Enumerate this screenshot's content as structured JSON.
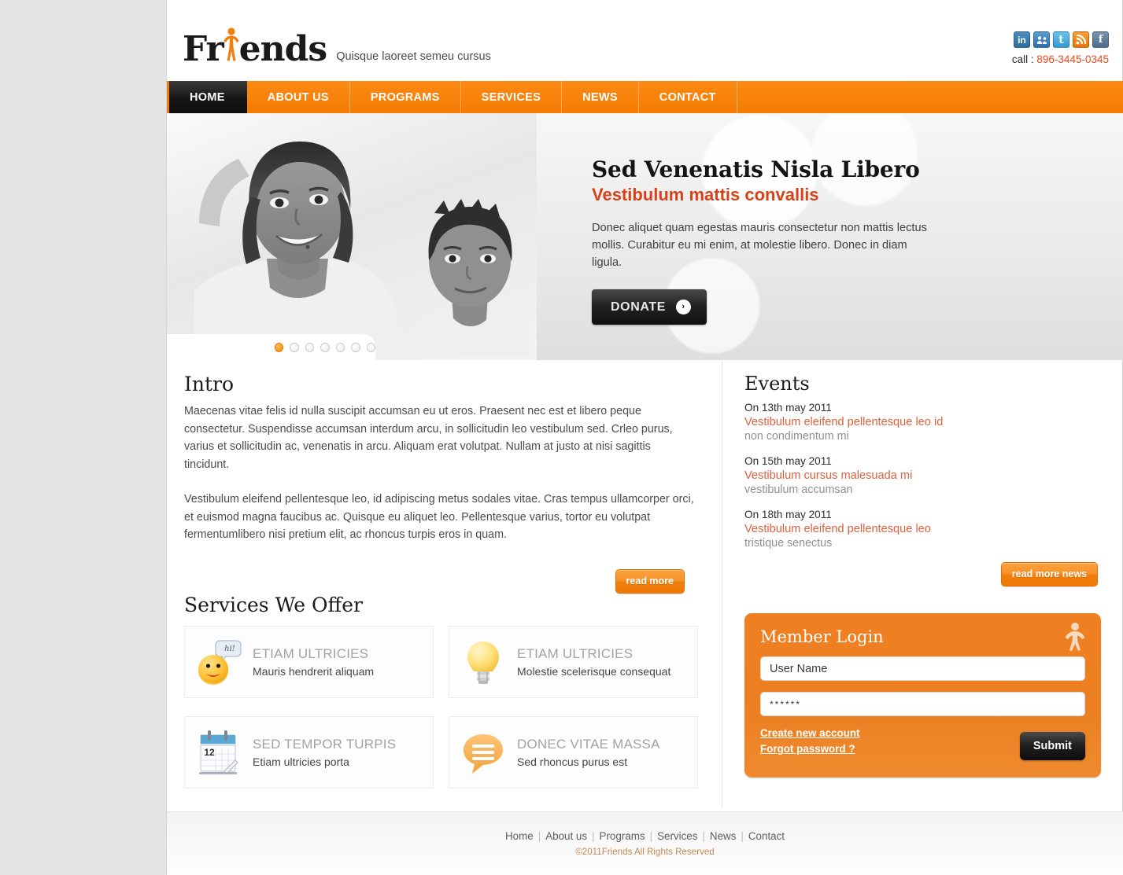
{
  "header": {
    "logo_main_1": "Fr",
    "logo_main_2": "ends",
    "logo_icon": "person-raised-arms-icon",
    "tagline": "Quisque laoreet semeu cursus",
    "call_label": "call : ",
    "phone": "896-3445-0345",
    "social": [
      {
        "name": "linkedin-icon",
        "glyph": "in",
        "class": "sicon-linkedin"
      },
      {
        "name": "myspace-icon",
        "glyph": "⚘",
        "class": "sicon-myspace"
      },
      {
        "name": "twitter-icon",
        "glyph": "t",
        "class": "sicon-twitter"
      },
      {
        "name": "rss-icon",
        "glyph": "◠",
        "class": "sicon-rss"
      },
      {
        "name": "facebook-icon",
        "glyph": "f",
        "class": "sicon-facebook"
      }
    ]
  },
  "nav": {
    "items": [
      {
        "label": "HOME",
        "active": true
      },
      {
        "label": "ABOUT US",
        "active": false
      },
      {
        "label": "PROGRAMS",
        "active": false
      },
      {
        "label": "SERVICES",
        "active": false
      },
      {
        "label": "NEWS",
        "active": false
      },
      {
        "label": "CONTACT",
        "active": false
      }
    ]
  },
  "slider": {
    "heading": "Sed Venenatis Nisla Libero",
    "subheading": "Vestibulum mattis convallis",
    "body": "Donec aliquet quam egestas mauris consectetur non mattis lectus mollis. Curabitur eu mi enim, at molestie libero. Donec in diam ligula.",
    "button_label": "DONATE",
    "button_arrow": "›",
    "dots_total": 7,
    "dot_active_index": 0,
    "image_alt": "black-and-white photo of two smiling children"
  },
  "intro": {
    "title": "Intro",
    "paragraph1": "Maecenas vitae felis id nulla suscipit accumsan eu ut eros. Praesent nec est et libero peque consectetur. Suspendisse accumsan interdum arcu, in sollicitudin leo vestibulum sed. Crleo purus, varius et sollicitudin ac, venenatis in arcu. Aliquam erat volutpat. Nullam at justo at nisi sagittis tincidunt.",
    "paragraph2": "Vestibulum eleifend pellentesque leo, id adipiscing metus sodales vitae. Cras tempus ullamcorper orci, et euismod magna faucibus ac. Quisque eu aliquet leo. Pellentesque varius, tortor eu volutpat fermentumlibero nisi pretium elit, ac rhoncus turpis eros in quam.",
    "read_more": "read more"
  },
  "services": {
    "title": "Services We Offer",
    "items": [
      {
        "icon": "smiley-speech-icon",
        "title": "ETIAM ULTRICIES",
        "desc": "Mauris hendrerit aliquam",
        "bubble": "hi!"
      },
      {
        "icon": "lightbulb-icon",
        "title": "ETIAM ULTRICIES",
        "desc": "Molestie scelerisque consequat"
      },
      {
        "icon": "calendar-icon",
        "title": "SED TEMPOR TURPIS",
        "desc": "Etiam ultricies porta",
        "day": "12"
      },
      {
        "icon": "speech-bubble-icon",
        "title": "DONEC VITAE MASSA",
        "desc": "Sed rhoncus purus est"
      }
    ]
  },
  "events": {
    "title": "Events",
    "items": [
      {
        "date": "On 13th may 2011",
        "title": "Vestibulum eleifend pellentesque leo id",
        "sub": "non condimentum mi"
      },
      {
        "date": "On 15th may 2011",
        "title": "Vestibulum cursus malesuada mi",
        "sub": "vestibulum accumsan"
      },
      {
        "date": "On 18th may 2011",
        "title": "Vestibulum eleifend pellentesque leo",
        "sub": "tristique senectus"
      }
    ],
    "read_more": "read more news"
  },
  "login": {
    "title": "Member Login",
    "username_value": "User Name",
    "username_placeholder": "User Name",
    "password_value": "******",
    "create_account": "Create new account",
    "forgot_password": "Forgot password ?",
    "submit": "Submit",
    "icon": "person-raised-arms-icon"
  },
  "footer": {
    "links": [
      "Home",
      "About us",
      "Programs",
      "Services",
      "News",
      "Contact"
    ],
    "separator": "|",
    "copyright": "©2011Friends All Rights Reserved"
  },
  "colors": {
    "accent_orange": "#f57b03",
    "accent_red": "#d94118",
    "nav_active": "#101010",
    "page_bg": "#e3e3e3",
    "event_link": "#e0603c",
    "copyright": "#c08a52"
  }
}
